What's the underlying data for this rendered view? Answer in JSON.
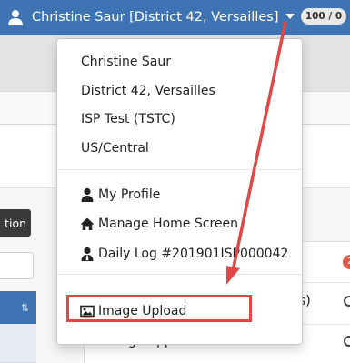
{
  "header": {
    "user_label": "Christine Saur [District 42, Versailles]",
    "score": "100 / 0"
  },
  "background": {
    "button_label": "tion",
    "sort_icon": "sort-icon",
    "badge": "2",
    "text_right": "s)",
    "text_bottom": "ng Supp"
  },
  "dropdown": {
    "user_name": "Christine Saur",
    "district": "District 42, Versailles",
    "organization": "ISP Test (TSTC)",
    "timezone": "US/Central",
    "items": [
      {
        "label": "My Profile",
        "icon": "user-icon"
      },
      {
        "label": "Manage Home Screen",
        "icon": "home-icon"
      },
      {
        "label": "Daily Log #201901ISP000042",
        "icon": "user-tie-icon"
      },
      {
        "label": "Image Upload",
        "icon": "image-icon"
      }
    ]
  },
  "annotation": {
    "highlight_color": "#e04848"
  }
}
